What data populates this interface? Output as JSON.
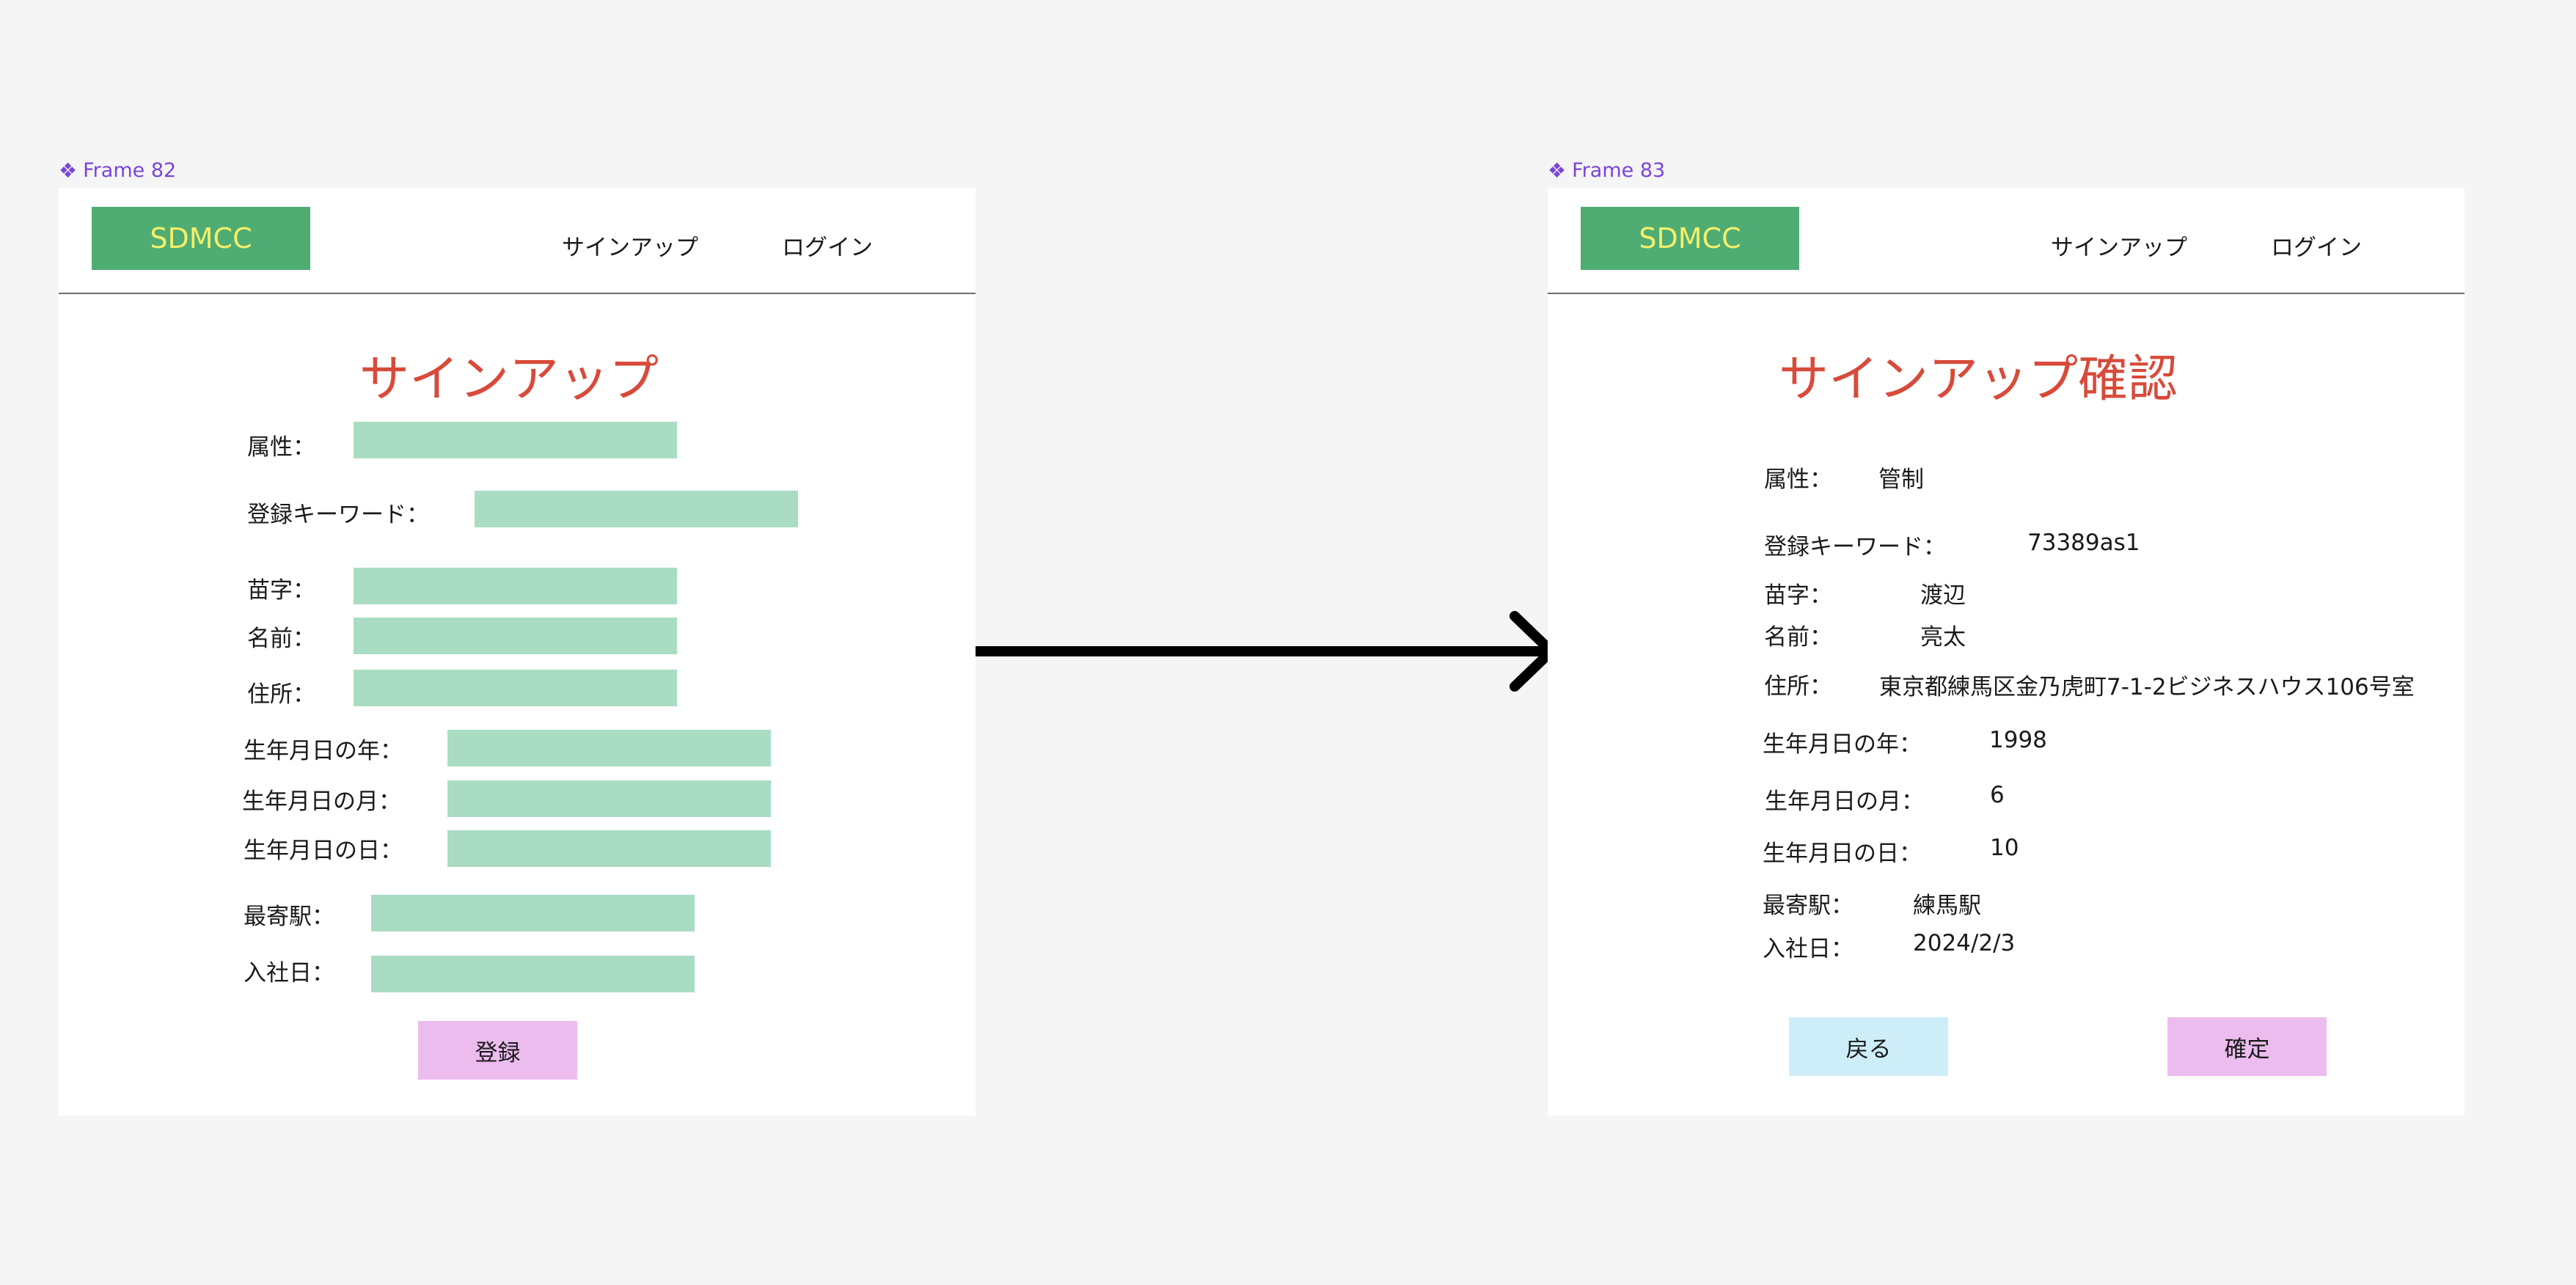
{
  "frames": {
    "left": {
      "label": "Frame 82"
    },
    "right": {
      "label": "Frame 83"
    }
  },
  "icons": {
    "component": "component-icon",
    "arrow": "arrow-right-icon"
  },
  "colors": {
    "background": "#f5f5f5",
    "logo_bg": "#4fac73",
    "logo_text": "#f4ef6a",
    "title": "#d84a3a",
    "input_bg": "#aadcc3",
    "submit_bg": "#ecbcef",
    "back_bg": "#cdeef8",
    "frame_label": "#7a45d8"
  },
  "header": {
    "logo": "SDMCC",
    "signup_link": "サインアップ",
    "login_link": "ログイン"
  },
  "signup": {
    "title": "サインアップ",
    "labels": {
      "attribute": "属性：",
      "keyword": "登録キーワード：",
      "surname": "苗字：",
      "name": "名前：",
      "address": "住所：",
      "birth_year": "生年月日の年：",
      "birth_month": "生年月日の月：",
      "birth_day": "生年月日の日：",
      "station": "最寄駅：",
      "join_date": "入社日："
    },
    "submit": "登録"
  },
  "confirm": {
    "title": "サインアップ確認",
    "labels": {
      "attribute": "属性：",
      "keyword": "登録キーワード：",
      "surname": "苗字：",
      "name": "名前：",
      "address": "住所：",
      "birth_year": "生年月日の年：",
      "birth_month": "生年月日の月：",
      "birth_day": "生年月日の日：",
      "station": "最寄駅：",
      "join_date": "入社日："
    },
    "values": {
      "attribute": "管制",
      "keyword": "73389as1",
      "surname": "渡辺",
      "name": "亮太",
      "address": "東京都練馬区金乃虎町7-1-2ビジネスハウス106号室",
      "birth_year": "1998",
      "birth_month": "6",
      "birth_day": "10",
      "station": "練馬駅",
      "join_date": "2024/2/3"
    },
    "back": "戻る",
    "confirm": "確定"
  }
}
